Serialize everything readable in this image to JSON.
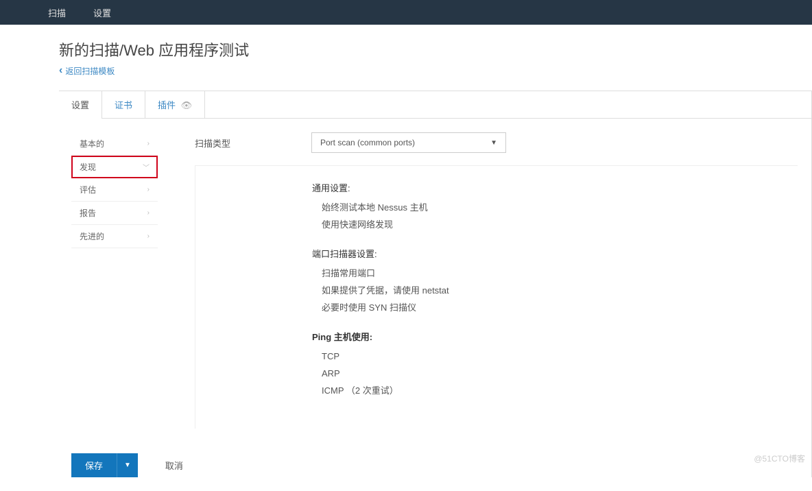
{
  "topbar": {
    "scan": "扫描",
    "settings": "设置"
  },
  "header": {
    "title": "新的扫描/Web 应用程序测试",
    "back": "返回扫描模板"
  },
  "tabs": {
    "settings": "设置",
    "certs": "证书",
    "plugins": "插件"
  },
  "sidebar": {
    "basic": "基本的",
    "discovery": "发现",
    "assessment": "评估",
    "report": "报告",
    "advanced": "先进的"
  },
  "form": {
    "scan_type_label": "扫描类型",
    "scan_type_value": "Port scan (common ports)"
  },
  "info": {
    "general_heading": "通用设置:",
    "general_lines": [
      "始终测试本地 Nessus 主机",
      "使用快速网络发现"
    ],
    "port_heading": "端口扫描器设置:",
    "port_lines": [
      "扫描常用端口",
      "如果提供了凭据，请使用 netstat",
      "必要时使用 SYN 扫描仪"
    ],
    "ping_heading": "Ping 主机使用:",
    "ping_lines": [
      "TCP",
      "ARP",
      "ICMP （2 次重试）"
    ]
  },
  "footer": {
    "save": "保存",
    "cancel": "取消"
  },
  "watermark": "@51CTO博客"
}
